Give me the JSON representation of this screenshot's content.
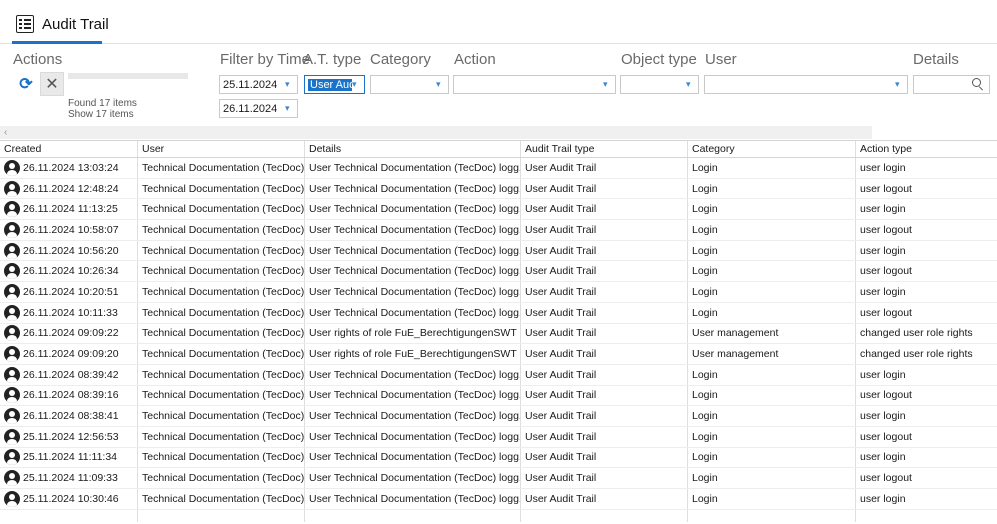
{
  "tab": {
    "label": "Audit Trail",
    "icon": "checklist-icon"
  },
  "filters": {
    "actions_label": "Actions",
    "filter_by_time_label": "Filter by Time",
    "at_type_label": "A.T. type",
    "category_label": "Category",
    "action_label": "Action",
    "object_type_label": "Object type",
    "user_label": "User",
    "details_label": "Details",
    "date_from": "25.11.2024",
    "date_to": "26.11.2024",
    "at_type_value": "User Audi",
    "category_value": "",
    "action_value": "",
    "object_type_value": "",
    "user_value": "",
    "details_value": ""
  },
  "status": {
    "found": "Found 17 items",
    "shown": "Show 17 items"
  },
  "columns": [
    "Created",
    "User",
    "Details",
    "Audit Trail type",
    "Category",
    "Action type"
  ],
  "rows": [
    [
      "26.11.2024 13:03:24",
      "Technical Documentation (TecDoc)",
      "User Technical Documentation (TecDoc) logg...",
      "User Audit Trail",
      "Login",
      "user login"
    ],
    [
      "26.11.2024 12:48:24",
      "Technical Documentation (TecDoc)",
      "User Technical Documentation (TecDoc) logg...",
      "User Audit Trail",
      "Login",
      "user logout"
    ],
    [
      "26.11.2024 11:13:25",
      "Technical Documentation (TecDoc)",
      "User Technical Documentation (TecDoc) logg...",
      "User Audit Trail",
      "Login",
      "user login"
    ],
    [
      "26.11.2024 10:58:07",
      "Technical Documentation (TecDoc)",
      "User Technical Documentation (TecDoc) logg...",
      "User Audit Trail",
      "Login",
      "user logout"
    ],
    [
      "26.11.2024 10:56:20",
      "Technical Documentation (TecDoc)",
      "User Technical Documentation (TecDoc) logg...",
      "User Audit Trail",
      "Login",
      "user login"
    ],
    [
      "26.11.2024 10:26:34",
      "Technical Documentation (TecDoc)",
      "User Technical Documentation (TecDoc) logg...",
      "User Audit Trail",
      "Login",
      "user logout"
    ],
    [
      "26.11.2024 10:20:51",
      "Technical Documentation (TecDoc)",
      "User Technical Documentation (TecDoc) logg...",
      "User Audit Trail",
      "Login",
      "user login"
    ],
    [
      "26.11.2024 10:11:33",
      "Technical Documentation (TecDoc)",
      "User Technical Documentation (TecDoc) logg...",
      "User Audit Trail",
      "Login",
      "user logout"
    ],
    [
      "26.11.2024 09:09:22",
      "Technical Documentation (TecDoc)",
      "User rights of role FuE_BerechtigungenSWT c...",
      "User Audit Trail",
      "User management",
      "changed user role rights"
    ],
    [
      "26.11.2024 09:09:20",
      "Technical Documentation (TecDoc)",
      "User rights of role FuE_BerechtigungenSWT c...",
      "User Audit Trail",
      "User management",
      "changed user role rights"
    ],
    [
      "26.11.2024 08:39:42",
      "Technical Documentation (TecDoc)",
      "User Technical Documentation (TecDoc) logg...",
      "User Audit Trail",
      "Login",
      "user login"
    ],
    [
      "26.11.2024 08:39:16",
      "Technical Documentation (TecDoc)",
      "User Technical Documentation (TecDoc) logg...",
      "User Audit Trail",
      "Login",
      "user logout"
    ],
    [
      "26.11.2024 08:38:41",
      "Technical Documentation (TecDoc)",
      "User Technical Documentation (TecDoc) logg...",
      "User Audit Trail",
      "Login",
      "user login"
    ],
    [
      "25.11.2024 12:56:53",
      "Technical Documentation (TecDoc)",
      "User Technical Documentation (TecDoc) logg...",
      "User Audit Trail",
      "Login",
      "user logout"
    ],
    [
      "25.11.2024 11:11:34",
      "Technical Documentation (TecDoc)",
      "User Technical Documentation (TecDoc) logg...",
      "User Audit Trail",
      "Login",
      "user login"
    ],
    [
      "25.11.2024 11:09:33",
      "Technical Documentation (TecDoc)",
      "User Technical Documentation (TecDoc) logg...",
      "User Audit Trail",
      "Login",
      "user logout"
    ],
    [
      "25.11.2024 10:30:46",
      "Technical Documentation (TecDoc)",
      "User Technical Documentation (TecDoc) logg...",
      "User Audit Trail",
      "Login",
      "user login"
    ]
  ],
  "colors": {
    "accent": "#1a73c9"
  }
}
